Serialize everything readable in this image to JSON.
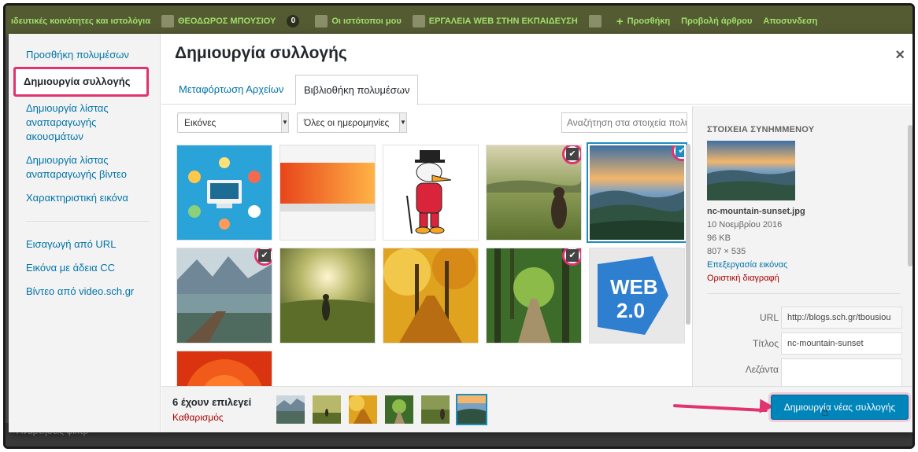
{
  "admin_bar": {
    "site": "ιδευτικές κοινότητες και ιστολόγια",
    "user": "ΘΕΟΔΩΡΟΣ ΜΠΟΥΣΙΟΥ",
    "count": "0",
    "my_sites": "Οι ιστότοποι μου",
    "site_name": "ΕΡΓΑΛΕΙΑ WEB ΣΤΗΝ ΕΚΠΑΙΔΕΥΣΗ",
    "add": "Προσθήκη",
    "view": "Προβολή άρθρου",
    "logout": "Αποσυνδεση"
  },
  "menu": {
    "items": [
      {
        "label": "Προσθήκη πολυμέσων"
      },
      {
        "label": "Δημιουργία συλλογής",
        "active": true
      },
      {
        "label": "Δημιουργία λίστας αναπαραγωγής ακουσμάτων"
      },
      {
        "label": "Δημιουργία λίστας αναπαραγωγής βίντεο"
      },
      {
        "label": "Χαρακτηριστική εικόνα"
      },
      {
        "label": "Εισαγωγή από URL"
      },
      {
        "label": "Εικόνα με άδεια CC"
      },
      {
        "label": "Βίντεο από video.sch.gr"
      }
    ]
  },
  "modal": {
    "title": "Δημιουργία συλλογής",
    "close": "×",
    "tabs": [
      "Μεταφόρτωση Αρχείων",
      "Βιβλιοθήκη πολυμέσων"
    ]
  },
  "toolbar": {
    "type_filter": "Εικόνες",
    "date_filter": "Όλες οι ημερομηνίες",
    "search_placeholder": "Αναζήτηση στα στοιχεία πολυ"
  },
  "details": {
    "heading": "ΣΤΟΙΧΕΙΑ ΣΥΝΗΜΜΕΝΟΥ",
    "filename": "nc-mountain-sunset.jpg",
    "date": "10 Νοεμβρίου 2016",
    "size": "96 KB",
    "dimensions": "807 × 535",
    "edit": "Επεξεργασία εικόνας",
    "delete": "Οριστική διαγραφή",
    "url_label": "URL",
    "url_value": "http://blogs.sch.gr/tbousiou",
    "title_label": "Τίτλος",
    "title_value": "nc-mountain-sunset",
    "caption_label": "Λεζάντα"
  },
  "footer": {
    "selected_count": "6 έχουν επιλεγεί",
    "clear": "Καθαρισμός",
    "create_button": "Δημιουργία νέας συλλογής"
  },
  "backdrop": {
    "text": "Αναρτήσεις φιλτρ"
  },
  "colors": {
    "accent": "#0085ba",
    "highlight": "#e0336f",
    "link": "#0073aa",
    "danger": "#a00000"
  }
}
